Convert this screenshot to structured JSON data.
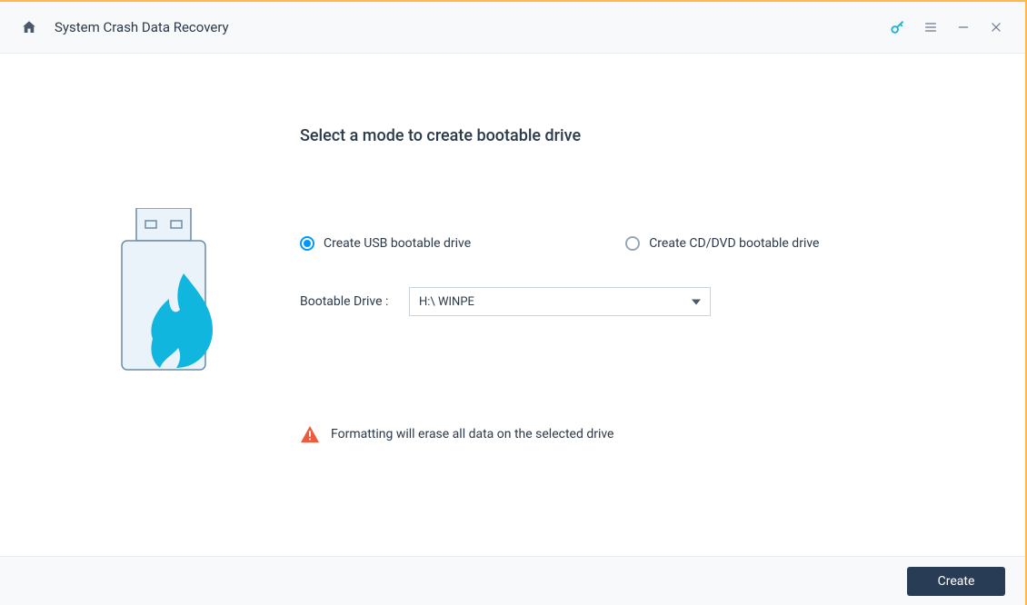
{
  "titlebar": {
    "title": "System Crash Data Recovery"
  },
  "main": {
    "heading": "Select a mode to create bootable drive",
    "options": {
      "usb_label": "Create USB bootable drive",
      "cd_label": "Create CD/DVD bootable drive",
      "selected": "usb"
    },
    "drive": {
      "label": "Bootable Drive :",
      "value": "H:\\ WINPE"
    },
    "warning": "Formatting will erase all data on the selected drive"
  },
  "footer": {
    "create_label": "Create"
  }
}
